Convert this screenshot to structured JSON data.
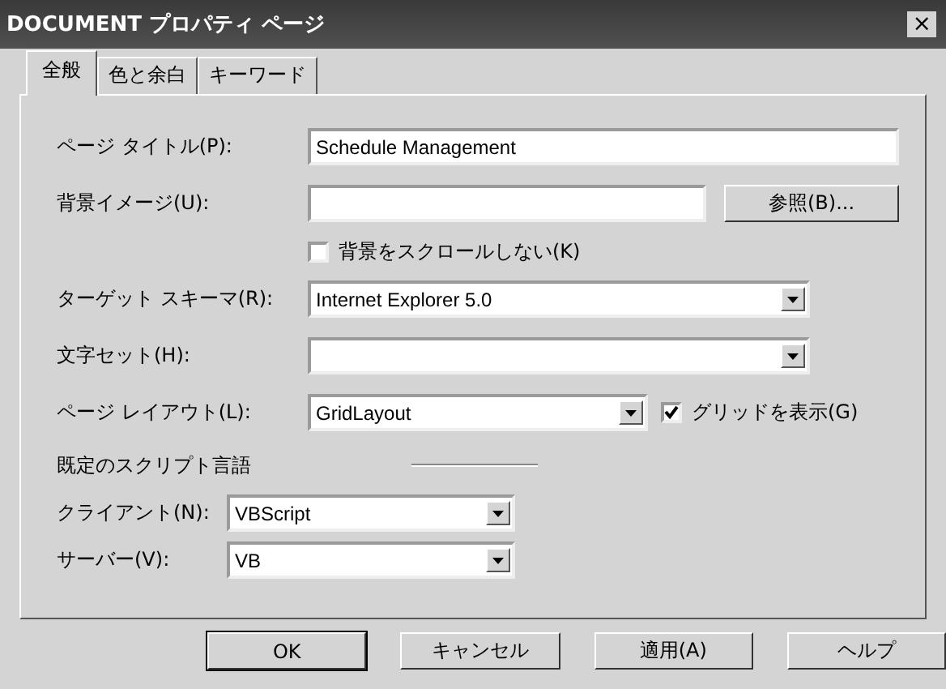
{
  "window": {
    "title": "DOCUMENT プロパティ ページ",
    "close": "×"
  },
  "tabs": [
    {
      "label": "全般",
      "selected": true
    },
    {
      "label": "色と余白",
      "selected": false
    },
    {
      "label": "キーワード",
      "selected": false
    }
  ],
  "rows": [
    {
      "kind": "text",
      "label": "ページ タイトル(P):",
      "value": "Schedule Management"
    },
    {
      "kind": "browse",
      "label": "背景イメージ(U):",
      "button": "参照(B)..."
    },
    {
      "kind": "checkbox",
      "label": "背景をスクロールしない(K)",
      "checked": false
    },
    {
      "kind": "dropdown",
      "label": "ターゲット スキーマ(R):",
      "value": "Internet Explorer 5.0"
    },
    {
      "kind": "dropdown",
      "label": "文字セット(H):"
    },
    {
      "kind": "dropdown_check",
      "label": "ページ レイアウト(L):",
      "value": "GridLayout",
      "check_label": "グリッドを表示(G)",
      "checked": true
    },
    {
      "kind": "group",
      "label": "既定のスクリプト言語"
    },
    {
      "kind": "small_dropdown",
      "label": "クライアント(N):",
      "value": "VBScript"
    },
    {
      "kind": "small_dropdown",
      "label": "サーバー(V):",
      "value": "VB"
    }
  ],
  "buttons": [
    {
      "label": "OK",
      "default": true
    },
    {
      "label": "キャンセル",
      "default": false
    },
    {
      "label": "適用(A)",
      "default": false
    },
    {
      "label": "ヘルプ",
      "default": false
    }
  ]
}
